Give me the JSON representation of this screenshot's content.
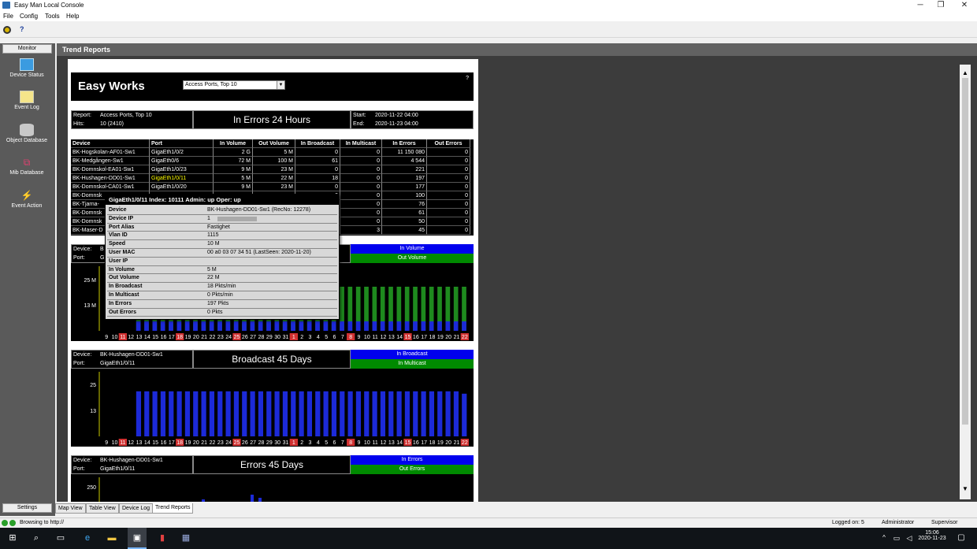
{
  "window": {
    "title": "Easy Man Local Console",
    "controls": [
      "─",
      "❐",
      "✕"
    ]
  },
  "menu": [
    "File",
    "Config",
    "Tools",
    "Help"
  ],
  "toolbar": {
    "help_label": "?"
  },
  "sidebar": {
    "header": "Monitor",
    "items": [
      {
        "label": "Device Status",
        "icon": "monitor-icon"
      },
      {
        "label": "Event Log",
        "icon": "event-log-icon"
      },
      {
        "label": "Object Database",
        "icon": "database-icon"
      },
      {
        "label": "Mib Database",
        "icon": "mib-icon"
      },
      {
        "label": "Event Action",
        "icon": "lightning-icon"
      }
    ],
    "settings": "Settings"
  },
  "content": {
    "header": "Trend Reports"
  },
  "report": {
    "brand": "Easy Works",
    "select_value": "Access Ports, Top 10",
    "help": "?",
    "info": {
      "report_label": "Report:",
      "report_value": "Access Ports, Top 10",
      "hits_label": "Hits:",
      "hits_value": "10 (2410)",
      "title": "In Errors 24 Hours",
      "start_label": "Start:",
      "start_value": "2020-11-22  04:00",
      "end_label": "End:",
      "end_value": "2020-11-23  04:00"
    },
    "columns": [
      "Device",
      "Port",
      "In Volume",
      "Out Volume",
      "In Broadcast",
      "In Multicast",
      "In Errors",
      "Out Errors"
    ],
    "rows": [
      [
        "BK-Hogskolan-AF01-Sw1",
        "GigaEth1/0/2",
        "2 G",
        "5 M",
        "0",
        "0",
        "11 150 080",
        "0"
      ],
      [
        "BK-Medgången-Sw1",
        "GigaEth0/6",
        "72 M",
        "100 M",
        "61",
        "0",
        "4 544",
        "0"
      ],
      [
        "BK-Domnskol-EA01-Sw1",
        "GigaEth1/0/23",
        "9 M",
        "23 M",
        "0",
        "0",
        "221",
        "0"
      ],
      [
        "BK-Hushagen-DD01-Sw1",
        "GigaEth1/0/11",
        "5 M",
        "22 M",
        "18",
        "0",
        "197",
        "0"
      ],
      [
        "BK-Domnskol-CA01-Sw1",
        "GigaEth1/0/20",
        "9 M",
        "23 M",
        "0",
        "0",
        "177",
        "0"
      ],
      [
        "BK-Domnsk",
        "",
        "",
        "",
        "0",
        "0",
        "100",
        "0"
      ],
      [
        "BK-Tjarna-",
        "",
        "",
        "",
        "0",
        "0",
        "76",
        "0"
      ],
      [
        "BK-Domnsk",
        "",
        "",
        "",
        "0",
        "0",
        "61",
        "0"
      ],
      [
        "BK-Domnsk",
        "",
        "",
        "",
        "0",
        "0",
        "50",
        "0"
      ],
      [
        "BK-Maser-D",
        "",
        "",
        "",
        "0",
        "3",
        "45",
        "0"
      ]
    ]
  },
  "tooltip": {
    "header": "GigaEth1/0/11     Index: 10111     Admin: up     Oper: up",
    "rows": [
      [
        "Device",
        "BK-Hushagen-DD01-Sw1  (RecNo: 12278)"
      ],
      [
        "Device IP",
        "1"
      ],
      [
        "Port Alias",
        "Fastighet"
      ],
      [
        "Vlan ID",
        "1115"
      ],
      [
        "Speed",
        "10 M"
      ],
      [
        "User MAC",
        "00 a0 03 07 34 51  (LastSeen: 2020-11-20)"
      ],
      [
        "User IP",
        ""
      ],
      [
        "In Volume",
        "5 M"
      ],
      [
        "Out Volume",
        "22 M"
      ],
      [
        "In Broadcast",
        "18 Pkts/min"
      ],
      [
        "In Multicast",
        "0 Pkts/min"
      ],
      [
        "In Errors",
        "197 Pkts"
      ],
      [
        "Out Errors",
        "0 Pkts"
      ]
    ]
  },
  "charts_meta": {
    "device_label": "Device:",
    "port_label": "Port:",
    "chart1": {
      "device": "B",
      "port": "G",
      "legend": [
        "In Volume",
        "Out Volume"
      ]
    },
    "chart2": {
      "device": "BK-Hushagen-DD01-Sw1",
      "port": "GigaEth1/0/11",
      "title": "Broadcast 45 Days",
      "legend": [
        "In Broadcast",
        "In Multicast"
      ]
    },
    "chart3": {
      "device": "BK-Hushagen-DD01-Sw1",
      "port": "GigaEth1/0/11",
      "title": "Errors 45 Days",
      "legend": [
        "In Errors",
        "Out Errors"
      ]
    }
  },
  "chart_data": [
    {
      "type": "bar",
      "ylabels": [
        "25 M",
        "13 M"
      ],
      "series": [
        {
          "name": "In Volume",
          "color": "#0000ff"
        },
        {
          "name": "Out Volume",
          "color": "#008000"
        }
      ],
      "categories": [
        "9",
        "10",
        "11",
        "12",
        "13",
        "14",
        "15",
        "16",
        "17",
        "18",
        "19",
        "20",
        "21",
        "22",
        "23",
        "24",
        "25",
        "26",
        "27",
        "28",
        "29",
        "30",
        "31",
        "1",
        "2",
        "3",
        "4",
        "5",
        "6",
        "7",
        "8",
        "9",
        "10",
        "11",
        "12",
        "13",
        "14",
        "15",
        "16",
        "17",
        "18",
        "19",
        "20",
        "21",
        "22"
      ],
      "highlight": [
        "11",
        "18",
        "25",
        "1",
        "8",
        "15",
        "22"
      ]
    },
    {
      "type": "bar",
      "ylabels": [
        "25",
        "13"
      ],
      "ylim": [
        0,
        30
      ],
      "series": [
        {
          "name": "In Broadcast",
          "color": "#0000ff",
          "values": [
            0,
            0,
            0,
            0,
            19,
            19,
            19,
            19,
            19,
            19,
            19,
            19,
            19,
            19,
            19,
            19,
            19,
            19,
            19,
            19,
            19,
            19,
            19,
            19,
            19,
            19,
            19,
            19,
            19,
            19,
            19,
            19,
            19,
            19,
            19,
            19,
            19,
            19,
            19,
            19,
            19,
            19,
            19,
            19,
            18
          ]
        }
      ],
      "categories": [
        "9",
        "10",
        "11",
        "12",
        "13",
        "14",
        "15",
        "16",
        "17",
        "18",
        "19",
        "20",
        "21",
        "22",
        "23",
        "24",
        "25",
        "26",
        "27",
        "28",
        "29",
        "30",
        "31",
        "1",
        "2",
        "3",
        "4",
        "5",
        "6",
        "7",
        "8",
        "9",
        "10",
        "11",
        "12",
        "13",
        "14",
        "15",
        "16",
        "17",
        "18",
        "19",
        "20",
        "21",
        "22"
      ],
      "highlight": [
        "11",
        "18",
        "25",
        "1",
        "8",
        "15",
        "22"
      ]
    },
    {
      "type": "bar",
      "ylabels": [
        "250"
      ],
      "series": [
        {
          "name": "In Errors",
          "color": "#0000ff"
        },
        {
          "name": "Out Errors",
          "color": "#008000"
        }
      ]
    }
  ],
  "tabs": [
    "Map View",
    "Table View",
    "Device Log",
    "Trend Reports"
  ],
  "status": {
    "browsing": "Browsing to http://",
    "logged_on": "Logged on: 5",
    "user": "Administrator",
    "role": "Supervisor"
  },
  "taskbar": {
    "time": "15:06",
    "date": "2020-11-23"
  }
}
